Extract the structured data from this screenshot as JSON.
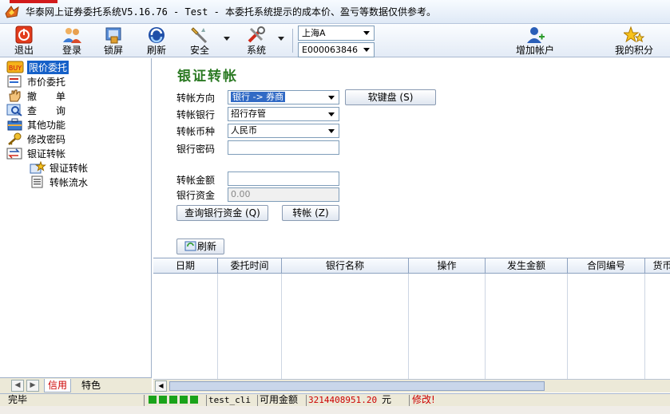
{
  "window": {
    "title": "华泰网上证券委托系统V5.16.76 - Test - 本委托系统提示的成本价、盈亏等数据仅供参考。"
  },
  "toolbar": {
    "exit": "退出",
    "login": "登录",
    "lock": "锁屏",
    "refresh": "刷新",
    "security": "安全",
    "system": "系统",
    "add_account": "增加帐户",
    "my_points": "我的积分",
    "market_select": "上海A",
    "account_select": "E000063846"
  },
  "tree": {
    "items": [
      "限价委托",
      "市价委托",
      "撤　　单",
      "查　　询",
      "其他功能",
      "修改密码",
      "银证转帐"
    ],
    "children": [
      "银证转帐",
      "转帐流水"
    ]
  },
  "left_tabs": {
    "tab1": "信用",
    "tab2": "特色"
  },
  "form": {
    "heading": "银证转帐",
    "direction_label": "转帐方向",
    "direction_value": "银行 -> 券商",
    "bank_label": "转帐银行",
    "bank_value": "招行存管",
    "currency_label": "转帐币种",
    "currency_value": "人民币",
    "password_label": "银行密码",
    "password_value": "",
    "amount_label": "转帐金额",
    "amount_value": "",
    "funds_label": "银行资金",
    "funds_value": "0.00",
    "soft_keyboard": "软键盘 (S)",
    "query_button": "查询银行资金 (Q)",
    "transfer_button": "转帐 (Z)",
    "refresh_button": "刷新"
  },
  "table": {
    "columns": [
      "日期",
      "委托时间",
      "银行名称",
      "操作",
      "发生金额",
      "合同编号",
      "货币"
    ]
  },
  "statusbar": {
    "state": "完毕",
    "client": "test_cli",
    "available_label": "可用金额",
    "available_value": "3214408951.20",
    "unit": "元",
    "warning": "修改!"
  },
  "colors": {
    "heading_green": "#2c7a24",
    "selection_blue": "#1560c8",
    "signal_green": "#1aa31a"
  }
}
